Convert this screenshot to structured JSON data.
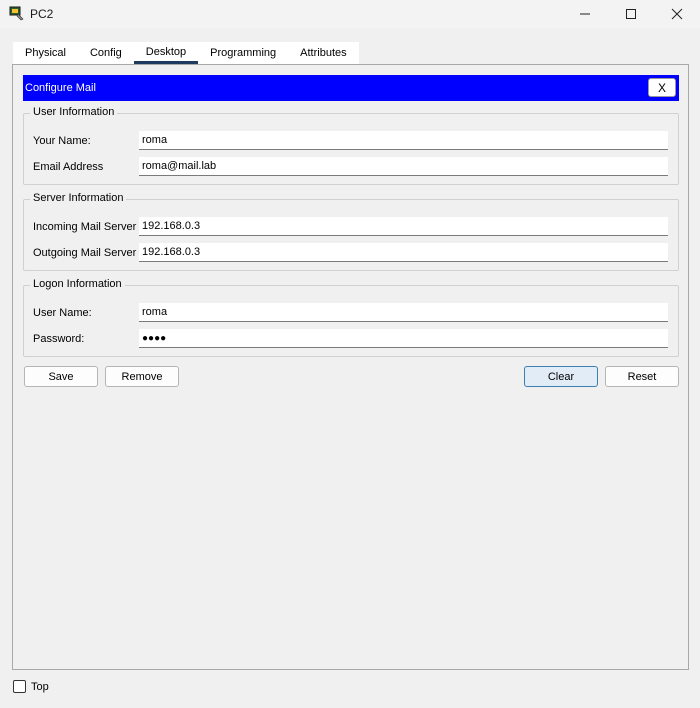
{
  "window": {
    "title": "PC2",
    "minimize_icon": "minimize-icon",
    "maximize_icon": "maximize-icon",
    "close_icon": "close-icon"
  },
  "tabs": [
    {
      "label": "Physical",
      "active": false
    },
    {
      "label": "Config",
      "active": false
    },
    {
      "label": "Desktop",
      "active": true
    },
    {
      "label": "Programming",
      "active": false
    },
    {
      "label": "Attributes",
      "active": false
    }
  ],
  "configure_mail": {
    "title": "Configure Mail",
    "close_label": "X",
    "header_color": "#0000ff",
    "user_info": {
      "legend": "User Information",
      "name_label": "Your Name:",
      "name_value": "roma",
      "email_label": "Email Address",
      "email_value": "roma@mail.lab"
    },
    "server_info": {
      "legend": "Server Information",
      "incoming_label": "Incoming Mail Server",
      "incoming_value": "192.168.0.3",
      "outgoing_label": "Outgoing Mail Server",
      "outgoing_value": "192.168.0.3"
    },
    "logon_info": {
      "legend": "Logon Information",
      "username_label": "User Name:",
      "username_value": "roma",
      "password_label": "Password:",
      "password_value": "●●●●"
    },
    "buttons": {
      "save": "Save",
      "remove": "Remove",
      "clear": "Clear",
      "reset": "Reset"
    }
  },
  "footer": {
    "top_label": "Top",
    "top_checked": false
  }
}
